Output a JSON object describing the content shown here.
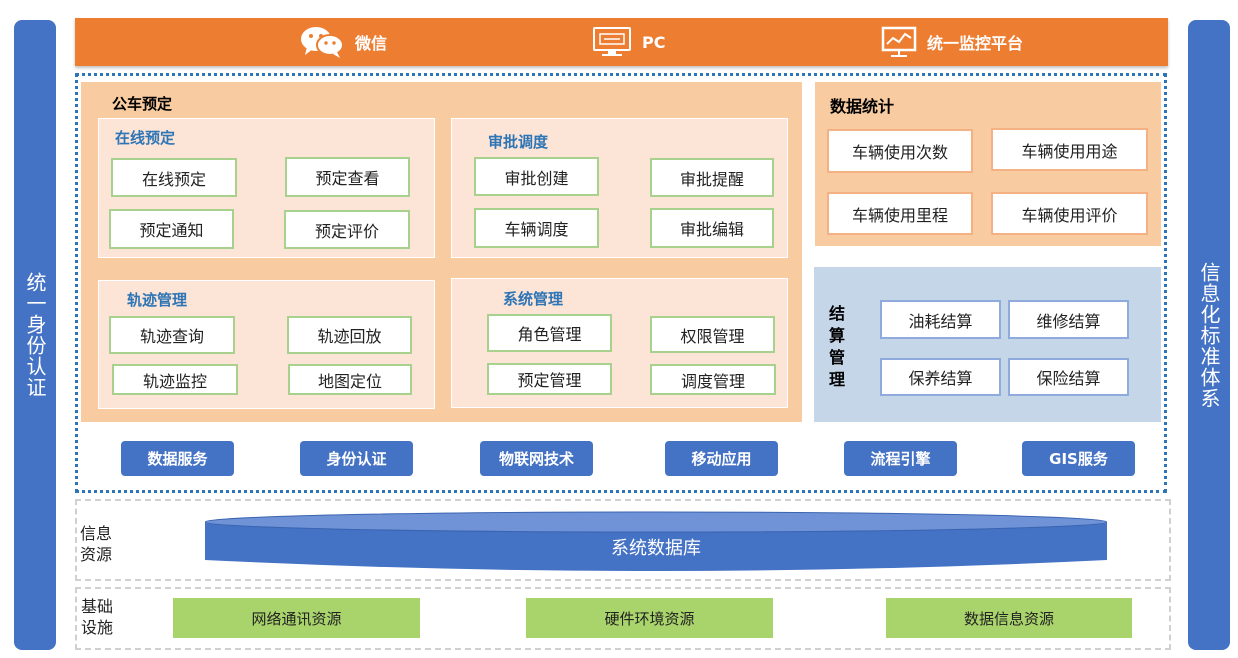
{
  "left_bar": "统一身份认证",
  "right_bar": "信息化标准体系",
  "top": {
    "wechat": "微信",
    "pc": "PC",
    "monitor": "统一监控平台"
  },
  "booking": {
    "title": "公车预定",
    "online": {
      "title": "在线预定",
      "items": [
        "在线预定",
        "预定查看",
        "预定通知",
        "预定评价"
      ]
    },
    "approval": {
      "title": "审批调度",
      "items": [
        "审批创建",
        "审批提醒",
        "车辆调度",
        "审批编辑"
      ]
    },
    "track": {
      "title": "轨迹管理",
      "items": [
        "轨迹查询",
        "轨迹回放",
        "轨迹监控",
        "地图定位"
      ]
    },
    "system": {
      "title": "系统管理",
      "items": [
        "角色管理",
        "权限管理",
        "预定管理",
        "调度管理"
      ]
    }
  },
  "stats": {
    "title": "数据统计",
    "items": [
      "车辆使用次数",
      "车辆使用用途",
      "车辆使用里程",
      "车辆使用评价"
    ]
  },
  "settlement": {
    "title": "结算管理",
    "items": [
      "油耗结算",
      "维修结算",
      "保养结算",
      "保险结算"
    ]
  },
  "services": [
    "数据服务",
    "身份认证",
    "物联网技术",
    "移动应用",
    "流程引擎",
    "GIS服务"
  ],
  "info_resources": {
    "label": "信息资源",
    "db": "系统数据库"
  },
  "infrastructure": {
    "label": "基础设施",
    "items": [
      "网络通讯资源",
      "硬件环境资源",
      "数据信息资源"
    ]
  },
  "colors": {
    "orange": "#ed7d31",
    "blue": "#4472c4",
    "green": "#a9d46b",
    "peach": "#f8cba0",
    "lightblue": "#c5d6e9"
  }
}
